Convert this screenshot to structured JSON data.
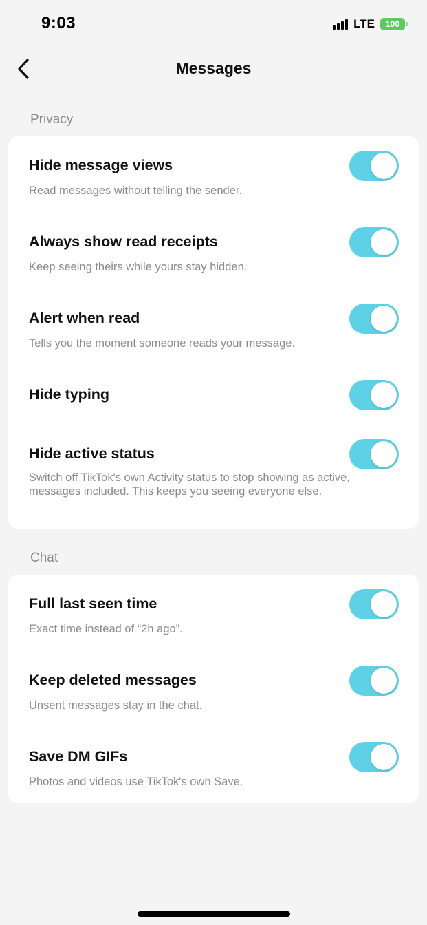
{
  "status_bar": {
    "time": "9:03",
    "network": "LTE",
    "battery": "100",
    "battery_color": "#5ec95e"
  },
  "header": {
    "title": "Messages",
    "back_icon": "chevron-left-icon"
  },
  "accent_color": "#5fd1e6",
  "sections": [
    {
      "label": "Privacy",
      "items": [
        {
          "title": "Hide message views",
          "description": "Read messages without telling the sender.",
          "enabled": true
        },
        {
          "title": "Always show read receipts",
          "description": "Keep seeing theirs while yours stay hidden.",
          "enabled": true
        },
        {
          "title": "Alert when read",
          "description": "Tells you the moment someone reads your message.",
          "enabled": true
        },
        {
          "title": "Hide typing",
          "description": "",
          "enabled": true
        },
        {
          "title": "Hide active status",
          "description": "Switch off TikTok's own Activity status to stop showing as active, messages included. This keeps you seeing everyone else.",
          "enabled": true
        }
      ]
    },
    {
      "label": "Chat",
      "items": [
        {
          "title": "Full last seen time",
          "description": "Exact time instead of “2h ago”.",
          "enabled": true
        },
        {
          "title": "Keep deleted messages",
          "description": "Unsent messages stay in the chat.",
          "enabled": true
        },
        {
          "title": "Save DM GIFs",
          "description": "Photos and videos use TikTok's own Save.",
          "enabled": true
        }
      ]
    }
  ]
}
